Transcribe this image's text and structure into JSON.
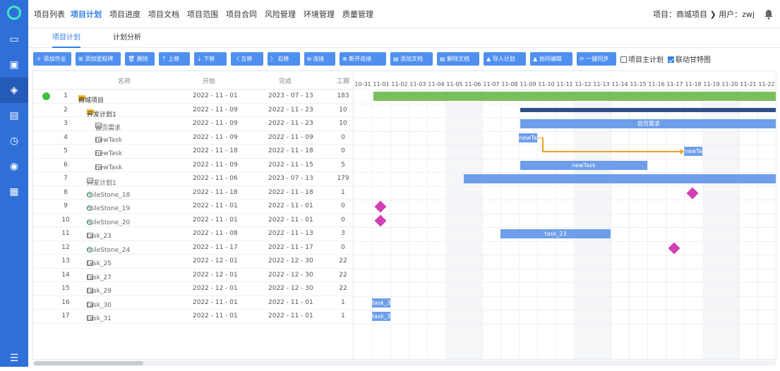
{
  "sidebar": {
    "icons": [
      "logo-icon",
      "monitor-icon",
      "note-icon",
      "layers-icon",
      "stack-icon",
      "clock-icon",
      "database-icon",
      "report-icon",
      "menu-icon"
    ]
  },
  "topnav": {
    "items": [
      "项目列表",
      "项目计划",
      "项目进度",
      "项目文档",
      "项目范围",
      "项目合同",
      "风险管理",
      "环境管理",
      "质量管理"
    ],
    "active": "项目计划",
    "project_info": "项目：商城项目 ❯ 用户：zwj"
  },
  "subtabs": [
    "项目计划",
    "计划分析"
  ],
  "toolbar": {
    "buttons": [
      "＋ 添加作业",
      "⊞ 添加里程碑",
      "🗑 删除",
      "⇡ 上移",
      "⇣ 下移",
      "〈 左移",
      "〉 右移",
      "⧉ 连接",
      "⊗ 断开连接",
      "▤ 添加文档",
      "▤ 解除文档",
      "▲ 导入计划",
      "▲ 协同编辑",
      "⟳ 一键同步"
    ],
    "checks": [
      {
        "label": "项目主计划",
        "checked": false
      },
      {
        "label": "联动甘特图",
        "checked": true
      }
    ]
  },
  "grid": {
    "headers": {
      "name": "名称",
      "start": "开始",
      "end": "完成",
      "duration": "工期"
    },
    "rows": [
      {
        "num": "1",
        "name": "商城项目",
        "start": "2022 - 11 - 01",
        "end": "2023 - 07 - 13",
        "dur": "183",
        "type": "folder",
        "level": 0,
        "toggle": "-",
        "status": true
      },
      {
        "num": "2",
        "name": "开发计划1",
        "start": "2022 - 11 - 09",
        "end": "2022 - 11 - 23",
        "dur": "10",
        "type": "folder",
        "level": 1,
        "toggle": "-"
      },
      {
        "num": "3",
        "name": "首页需求",
        "start": "2022 - 11 - 09",
        "end": "2022 - 11 - 23",
        "dur": "10",
        "type": "task",
        "level": 2
      },
      {
        "num": "4",
        "name": "newTask",
        "start": "2022 - 11 - 09",
        "end": "2022 - 11 - 09",
        "dur": "0",
        "type": "task",
        "level": 2
      },
      {
        "num": "5",
        "name": "newTask",
        "start": "2022 - 11 - 18",
        "end": "2022 - 11 - 18",
        "dur": "0",
        "type": "task",
        "level": 2
      },
      {
        "num": "6",
        "name": "newTask",
        "start": "2022 - 11 - 09",
        "end": "2022 - 11 - 15",
        "dur": "5",
        "type": "task",
        "level": 2
      },
      {
        "num": "7",
        "name": "开发计划1",
        "start": "2022 - 11 - 06",
        "end": "2023 - 07 - 13",
        "dur": "179",
        "type": "task",
        "level": 1
      },
      {
        "num": "8",
        "name": "mileStone_18",
        "start": "2022 - 11 - 18",
        "end": "2022 - 11 - 18",
        "dur": "1",
        "type": "milestone",
        "level": 1
      },
      {
        "num": "9",
        "name": "mileStone_19",
        "start": "2022 - 11 - 01",
        "end": "2022 - 11 - 01",
        "dur": "0",
        "type": "milestone",
        "level": 1
      },
      {
        "num": "10",
        "name": "mileStone_20",
        "start": "2022 - 11 - 01",
        "end": "2022 - 11 - 01",
        "dur": "0",
        "type": "milestone",
        "level": 1
      },
      {
        "num": "11",
        "name": "task_23",
        "start": "2022 - 11 - 08",
        "end": "2022 - 11 - 13",
        "dur": "3",
        "type": "task",
        "level": 1
      },
      {
        "num": "12",
        "name": "mileStone_24",
        "start": "2022 - 11 - 17",
        "end": "2022 - 11 - 17",
        "dur": "0",
        "type": "milestone",
        "level": 1
      },
      {
        "num": "13",
        "name": "task_25",
        "start": "2022 - 12 - 01",
        "end": "2022 - 12 - 30",
        "dur": "22",
        "type": "task",
        "level": 1
      },
      {
        "num": "14",
        "name": "task_27",
        "start": "2022 - 12 - 01",
        "end": "2022 - 12 - 30",
        "dur": "22",
        "type": "task",
        "level": 1
      },
      {
        "num": "15",
        "name": "task_29",
        "start": "2022 - 12 - 01",
        "end": "2022 - 12 - 30",
        "dur": "22",
        "type": "task",
        "level": 1
      },
      {
        "num": "16",
        "name": "task_30",
        "start": "2022 - 11 - 01",
        "end": "2022 - 11 - 01",
        "dur": "1",
        "type": "task",
        "level": 1
      },
      {
        "num": "17",
        "name": "task_31",
        "start": "2022 - 11 - 01",
        "end": "2022 - 11 - 01",
        "dur": "1",
        "type": "task",
        "level": 1
      }
    ]
  },
  "gantt": {
    "dates": [
      "10-31",
      "11-01",
      "11-02",
      "11-03",
      "11-04",
      "11-05",
      "11-06",
      "11-07",
      "11-08",
      "11-09",
      "11-10",
      "11-11",
      "11-12",
      "11-13",
      "11-14",
      "11-15",
      "11-16",
      "11-17",
      "11-18",
      "11-19",
      "11-20",
      "11-21",
      "11-22"
    ],
    "bar_labels": {
      "row3": "首页需求",
      "row4": "newTa",
      "row5": "newTa",
      "row6": "newTask",
      "row11": "task_23",
      "row16": "task_3",
      "row17": "task_3"
    }
  }
}
